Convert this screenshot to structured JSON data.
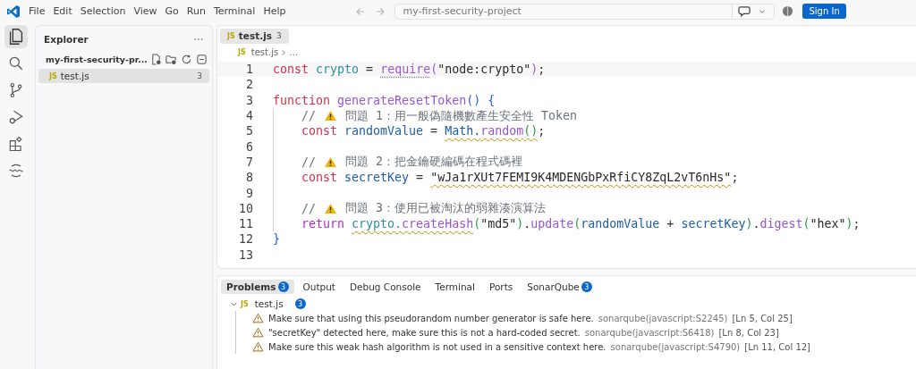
{
  "menu": [
    "File",
    "Edit",
    "Selection",
    "View",
    "Go",
    "Run",
    "Terminal",
    "Help"
  ],
  "command_center": {
    "value": "my-first-security-project"
  },
  "sign_in": "Sign In",
  "activity_bar": [
    {
      "selected": true
    },
    {
      "selected": false
    },
    {
      "selected": false
    },
    {
      "selected": false
    },
    {
      "selected": false
    },
    {
      "selected": false
    }
  ],
  "sidebar": {
    "title": "Explorer",
    "folder": {
      "name": "my-first-security-pr...",
      "expanded": true,
      "files": [
        {
          "type_label": "JS",
          "name": "test.js",
          "badge": "3",
          "selected": true
        }
      ]
    }
  },
  "editor": {
    "tabs": [
      {
        "type_label": "JS",
        "label": "test.js",
        "badge": "3",
        "selected": true
      }
    ],
    "breadcrumb": {
      "type_label": "JS",
      "file": "test.js",
      "rest": "…"
    },
    "lines": [
      {
        "number": "1",
        "active": true,
        "indented": false,
        "tokens": [
          {
            "kind": "keyword",
            "text": "const "
          },
          {
            "kind": "module",
            "text": "crypto"
          },
          {
            "kind": "plain",
            "text": " = "
          },
          {
            "kind": "function",
            "text": "require",
            "hint": true
          },
          {
            "kind": "bracket_outer",
            "text": "("
          },
          {
            "kind": "string",
            "text": "\"node:crypto\""
          },
          {
            "kind": "bracket_outer",
            "text": ")"
          },
          {
            "kind": "plain",
            "text": ";"
          }
        ]
      },
      {
        "number": "2",
        "active": false,
        "indented": false
      },
      {
        "number": "3",
        "active": false,
        "indented": false,
        "tokens": [
          {
            "kind": "keyword",
            "text": "function "
          },
          {
            "kind": "function",
            "text": "generateResetToken"
          },
          {
            "kind": "bracket",
            "text": "() {"
          }
        ]
      },
      {
        "number": "4",
        "active": false,
        "indented": true,
        "tokens": [
          {
            "kind": "comment",
            "text": "// "
          },
          {
            "kind": "warning"
          },
          {
            "kind": "comment",
            "text": " 問題 1：用一般偽隨機數產生安全性 Token"
          }
        ]
      },
      {
        "number": "5",
        "active": false,
        "indented": true,
        "tokens": [
          {
            "kind": "keyword",
            "text": "const "
          },
          {
            "kind": "variable",
            "text": "randomValue"
          },
          {
            "kind": "plain",
            "text": " = "
          },
          {
            "kind": "variable",
            "text": "Math.",
            "warn": true
          },
          {
            "kind": "function",
            "text": "random",
            "warn": true
          },
          {
            "kind": "bracket_inner",
            "text": "()",
            "warn": true
          },
          {
            "kind": "plain",
            "text": ";"
          }
        ]
      },
      {
        "number": "6",
        "active": false,
        "indented": true
      },
      {
        "number": "7",
        "active": false,
        "indented": true,
        "tokens": [
          {
            "kind": "comment",
            "text": "// "
          },
          {
            "kind": "warning"
          },
          {
            "kind": "comment",
            "text": " 問題 2：把金鑰硬編碼在程式碼裡"
          }
        ]
      },
      {
        "number": "8",
        "active": false,
        "indented": true,
        "tokens": [
          {
            "kind": "keyword",
            "text": "const "
          },
          {
            "kind": "variable",
            "text": "secretKey"
          },
          {
            "kind": "plain",
            "text": " = "
          },
          {
            "kind": "string",
            "text": "\"wJa1rXUt7FEMI9K4MDENGbPxRfiCY8ZqL2vT6nHs\"",
            "warn": true
          },
          {
            "kind": "plain",
            "text": ";"
          }
        ]
      },
      {
        "number": "9",
        "active": false,
        "indented": true
      },
      {
        "number": "10",
        "active": false,
        "indented": true,
        "tokens": [
          {
            "kind": "comment",
            "text": "// "
          },
          {
            "kind": "warning"
          },
          {
            "kind": "comment",
            "text": " 問題 3：使用已被淘汰的弱雜湊演算法"
          }
        ]
      },
      {
        "number": "11",
        "active": false,
        "indented": true,
        "tokens": [
          {
            "kind": "control",
            "text": "return "
          },
          {
            "kind": "module",
            "text": "crypto.",
            "warn": true
          },
          {
            "kind": "function",
            "text": "createHash",
            "warn": true
          },
          {
            "kind": "bracket_inner",
            "text": "("
          },
          {
            "kind": "string",
            "text": "\"md5\""
          },
          {
            "kind": "bracket_inner",
            "text": ")"
          },
          {
            "kind": "plain",
            "text": "."
          },
          {
            "kind": "function",
            "text": "update"
          },
          {
            "kind": "bracket_inner",
            "text": "("
          },
          {
            "kind": "variable",
            "text": "randomValue"
          },
          {
            "kind": "plain",
            "text": " + "
          },
          {
            "kind": "variable",
            "text": "secretKey"
          },
          {
            "kind": "bracket_inner",
            "text": ")"
          },
          {
            "kind": "plain",
            "text": "."
          },
          {
            "kind": "function",
            "text": "digest"
          },
          {
            "kind": "bracket_inner",
            "text": "("
          },
          {
            "kind": "string",
            "text": "\"hex\""
          },
          {
            "kind": "bracket_inner",
            "text": ")"
          },
          {
            "kind": "plain",
            "text": ";"
          }
        ]
      },
      {
        "number": "12",
        "active": false,
        "indented": false,
        "tokens": [
          {
            "kind": "bracket",
            "text": "}"
          }
        ]
      },
      {
        "number": "13",
        "active": false,
        "indented": false
      }
    ]
  },
  "panel": {
    "tabs": [
      {
        "label": "Problems",
        "badge": "3",
        "selected": true
      },
      {
        "label": "Output",
        "selected": false
      },
      {
        "label": "Debug Console",
        "selected": false
      },
      {
        "label": "Terminal",
        "selected": false
      },
      {
        "label": "Ports",
        "selected": false
      },
      {
        "label": "SonarQube",
        "badge": "3",
        "selected": false
      }
    ],
    "problems": {
      "type_label": "JS",
      "file": "test.js",
      "count": "3",
      "expanded": true,
      "items": [
        {
          "message": "Make sure that using this pseudorandom number generator is safe here.",
          "source": "sonarqube(javascript:S2245)",
          "location": "[Ln 5, Col 25]"
        },
        {
          "message": "\"secretKey\" detected here, make sure this is not a hard-coded secret.",
          "source": "sonarqube(javascript:S6418)",
          "location": "[Ln 8, Col 23]"
        },
        {
          "message": "Make sure this weak hash algorithm is not used in a sensitive context here.",
          "source": "sonarqube(javascript:S4790)",
          "location": "[Ln 11, Col 12]"
        }
      ]
    }
  }
}
